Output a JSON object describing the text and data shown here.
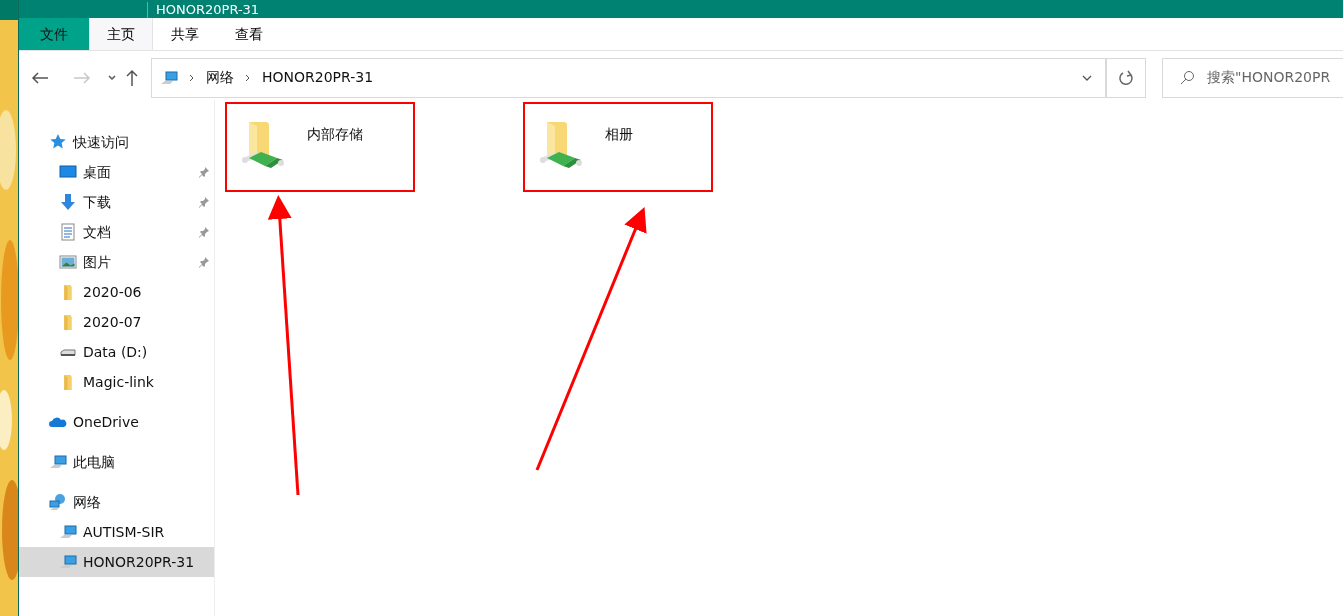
{
  "window": {
    "title": "HONOR20PR-31"
  },
  "ribbon_tabs": [
    {
      "label": "文件",
      "kind": "file",
      "selected": false
    },
    {
      "label": "主页",
      "kind": "tab",
      "selected": true
    },
    {
      "label": "共享",
      "kind": "tab",
      "selected": false
    },
    {
      "label": "查看",
      "kind": "tab",
      "selected": false
    }
  ],
  "address_bar": {
    "path": [
      "网络",
      "HONOR20PR-31"
    ]
  },
  "search": {
    "placeholder": "搜索\"HONOR20PR"
  },
  "sidebar": [
    {
      "label": "快速访问",
      "kind": "star",
      "selected": false,
      "children": [
        {
          "label": "桌面",
          "kind": "desktop",
          "pinned": true,
          "selected": false
        },
        {
          "label": "下载",
          "kind": "download",
          "pinned": true,
          "selected": false
        },
        {
          "label": "文档",
          "kind": "document",
          "pinned": true,
          "selected": false
        },
        {
          "label": "图片",
          "kind": "pictures",
          "pinned": true,
          "selected": false
        },
        {
          "label": "2020-06",
          "kind": "folder",
          "pinned": false,
          "selected": false
        },
        {
          "label": "2020-07",
          "kind": "folder",
          "pinned": false,
          "selected": false
        },
        {
          "label": "Data (D:)",
          "kind": "drive",
          "pinned": false,
          "selected": false
        },
        {
          "label": "Magic-link",
          "kind": "folder",
          "pinned": false,
          "selected": false
        }
      ]
    },
    {
      "label": "OneDrive",
      "kind": "cloud",
      "selected": false
    },
    {
      "label": "此电脑",
      "kind": "pc",
      "selected": false
    },
    {
      "label": "网络",
      "kind": "network",
      "selected": false,
      "children": [
        {
          "label": "AUTISM-SIR",
          "kind": "pc",
          "pinned": false,
          "selected": false
        },
        {
          "label": "HONOR20PR-31",
          "kind": "pc",
          "pinned": false,
          "selected": true
        }
      ]
    }
  ],
  "items": [
    {
      "label": "内部存储",
      "highlighted": true
    },
    {
      "label": "相册",
      "highlighted": true
    }
  ]
}
